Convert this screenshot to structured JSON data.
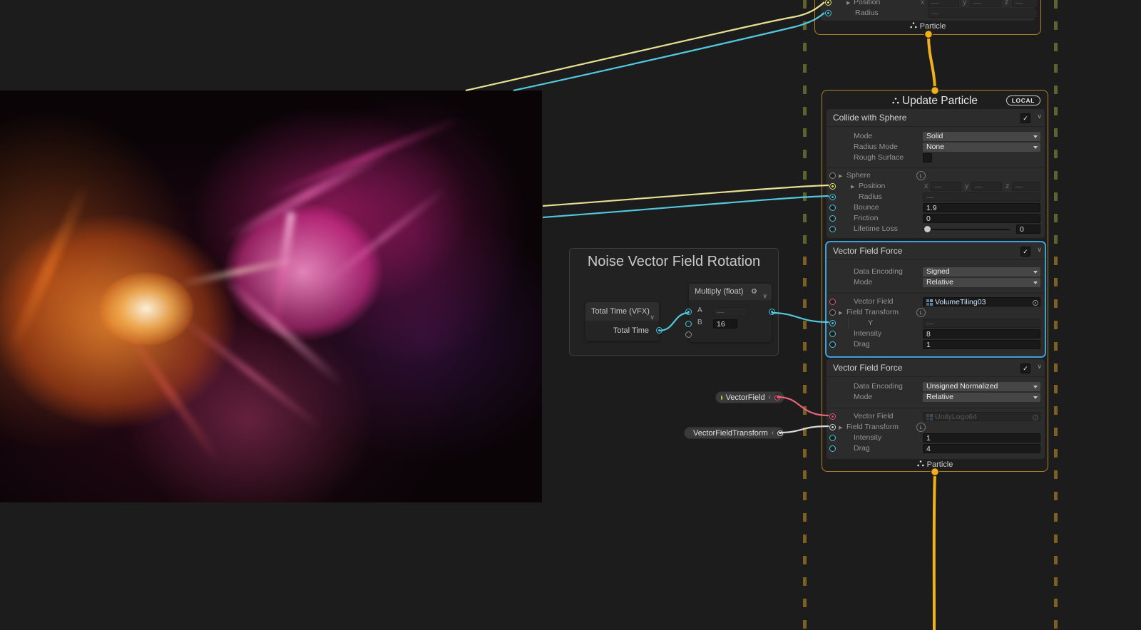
{
  "dash": "—",
  "check": "✓",
  "axis": {
    "x": "x",
    "y": "y",
    "z": "z"
  },
  "colors": {
    "canvas_bg": "#1c1c1c",
    "context_border": "#b08427",
    "selection_accent": "#3f9fdf",
    "flow_link": "#f2b01c",
    "wire_yellow": "#e6e192",
    "wire_cyan": "#52c8de",
    "wire_pink": "#e66478",
    "wire_white": "#dadada",
    "dash_green": "#5c6330",
    "dash_gold": "#7a6022",
    "exposed_dot": "#b9d837"
  },
  "icons": {
    "particle": "particle-icon",
    "gear": "settings-gear-icon",
    "chevron_down": "chevron-down-icon",
    "chevron_left": "chevron-left-icon",
    "foldout": "foldout-arrow-icon",
    "texture": "texture-icon",
    "object_picker": "object-picker-icon",
    "local_space": "local-space-badge"
  },
  "top_node": {
    "position_label": "Position",
    "radius_label": "Radius",
    "output_label": "Particle"
  },
  "update_node": {
    "title": "Update Particle",
    "badge": "LOCAL",
    "output_label": "Particle",
    "collide": {
      "title": "Collide with Sphere",
      "rows": {
        "mode": "Mode",
        "radius_mode": "Radius Mode",
        "rough": "Rough Surface",
        "sphere": "Sphere",
        "position": "Position",
        "radius": "Radius",
        "bounce": "Bounce",
        "friction": "Friction",
        "lifetime": "Lifetime Loss"
      },
      "values": {
        "mode": "Solid",
        "radius_mode": "None",
        "bounce": "1.9",
        "friction": "0",
        "lifetime": "0"
      },
      "badge_l": "L"
    },
    "vff1": {
      "title": "Vector Field Force",
      "rows": {
        "encoding": "Data Encoding",
        "mode": "Mode",
        "field": "Vector Field",
        "transform": "Field Transform",
        "y": "Y",
        "intensity": "Intensity",
        "drag": "Drag"
      },
      "values": {
        "encoding": "Signed",
        "mode": "Relative",
        "field": "VolumeTiling03",
        "intensity": "8",
        "drag": "1"
      },
      "badge_l": "L"
    },
    "vff2": {
      "title": "Vector Field Force",
      "rows": {
        "encoding": "Data Encoding",
        "mode": "Mode",
        "field": "Vector Field",
        "transform": "Field Transform",
        "intensity": "Intensity",
        "drag": "Drag"
      },
      "values": {
        "encoding": "Unsigned Normalized",
        "mode": "Relative",
        "field": "UnityLogo64",
        "intensity": "1",
        "drag": "4"
      },
      "badge_l": "L"
    }
  },
  "group": {
    "title": "Noise Vector Field Rotation"
  },
  "total_time_node": {
    "title": "Total Time (VFX)",
    "output_label": "Total Time"
  },
  "multiply_node": {
    "title": "Multiply (float)",
    "a_label": "A",
    "b_label": "B",
    "b_value": "16"
  },
  "pills": {
    "field": "VectorField",
    "transform": "VectorFieldTransform"
  }
}
